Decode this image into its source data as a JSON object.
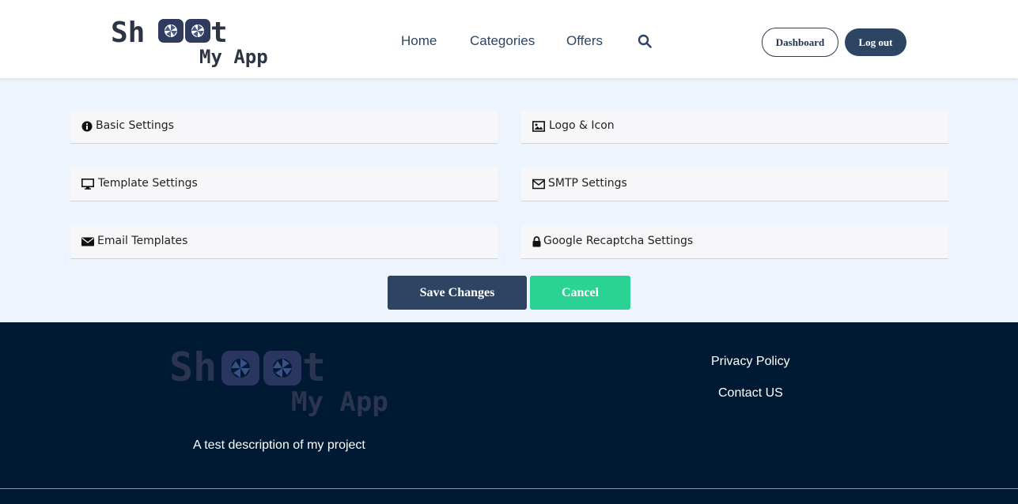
{
  "brand": {
    "line1": "Sh",
    "line1_end": "t",
    "line2": "My App",
    "colors": {
      "primary": "#2d4562",
      "accent": "#2ad394",
      "footer_bg": "#001a33",
      "page_bg": "#edf4fd"
    }
  },
  "nav": {
    "home": "Home",
    "categories": "Categories",
    "offers": "Offers",
    "search_icon": "search-icon"
  },
  "header": {
    "dashboard": "Dashboard",
    "logout": "Log out"
  },
  "settings": {
    "panels": [
      {
        "label": "Basic Settings",
        "icon": "info-circle-icon"
      },
      {
        "label": "Logo & Icon",
        "icon": "image-icon"
      },
      {
        "label": "Template Settings",
        "icon": "desktop-icon"
      },
      {
        "label": "SMTP Settings",
        "icon": "envelope-outline-icon"
      },
      {
        "label": "Email Templates",
        "icon": "envelope-icon"
      },
      {
        "label": "Google Recaptcha Settings",
        "icon": "lock-icon"
      }
    ],
    "save": "Save Changes",
    "cancel": "Cancel"
  },
  "footer": {
    "description": "A test description of my project",
    "links": [
      "Privacy Policy",
      "Contact US"
    ]
  }
}
